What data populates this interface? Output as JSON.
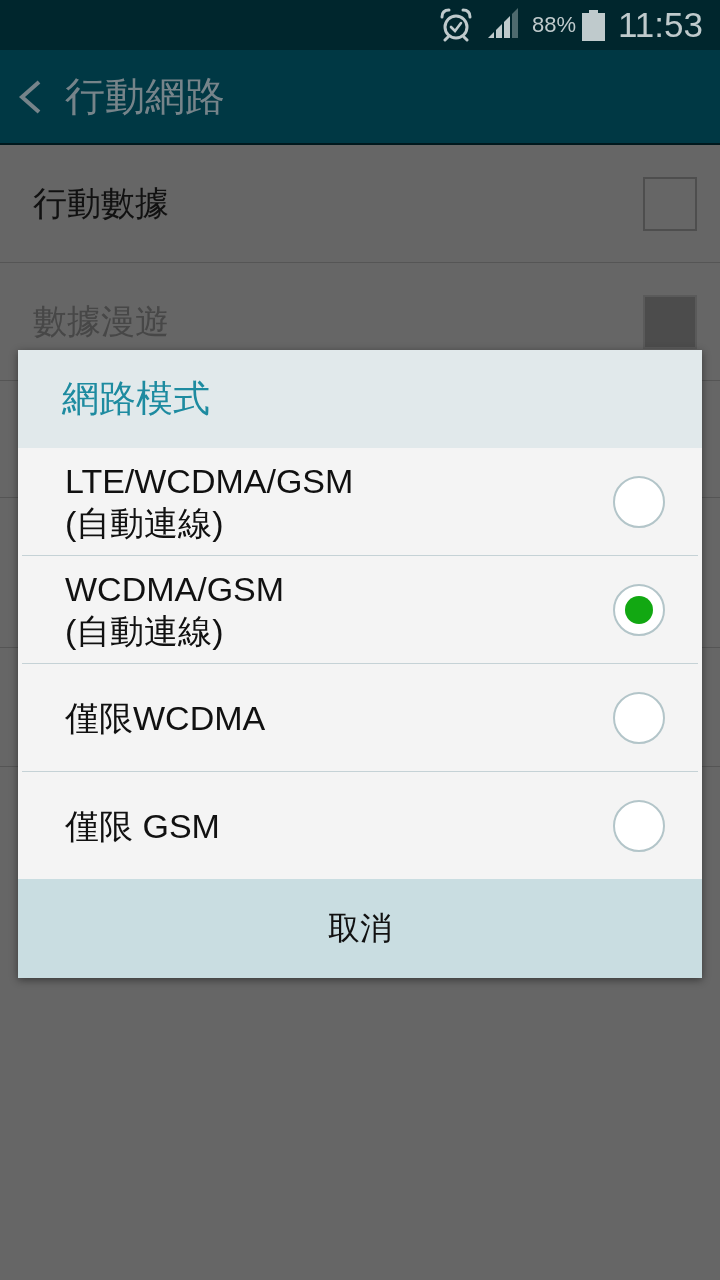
{
  "status_bar": {
    "battery": "88%",
    "time": "11:53"
  },
  "header": {
    "title": "行動網路"
  },
  "settings": [
    {
      "label": "行動數據",
      "checked": false,
      "disabled": false
    },
    {
      "label": "數據漫遊",
      "checked": false,
      "disabled": true
    }
  ],
  "dialog": {
    "title": "網路模式",
    "options": [
      {
        "label": "LTE/WCDMA/GSM (自動連線)",
        "selected": false
      },
      {
        "label": "WCDMA/GSM (自動連線)",
        "selected": true
      },
      {
        "label": "僅限WCDMA",
        "selected": false
      },
      {
        "label": "僅限 GSM",
        "selected": false
      }
    ],
    "buttons": [
      "取消"
    ]
  }
}
